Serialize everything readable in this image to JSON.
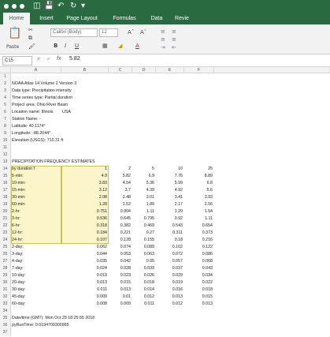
{
  "ribbon": {
    "tabs": [
      {
        "label": "Home",
        "active": true
      },
      {
        "label": "Insert",
        "active": false
      },
      {
        "label": "Page Layout",
        "active": false
      },
      {
        "label": "Formulas",
        "active": false
      },
      {
        "label": "Data",
        "active": false
      },
      {
        "label": "Revie",
        "active": false
      }
    ],
    "paste_label": "Paste",
    "font_name": "Calibri (Body)",
    "font_size": "12",
    "bold": "B",
    "italic": "I",
    "underline": "U"
  },
  "formula_bar": {
    "name_box": "C15",
    "fx": "fx",
    "value": "5.82"
  },
  "columns": [
    "A",
    "B",
    "C",
    "D",
    "E",
    "F"
  ],
  "rows": [
    {
      "n": "1",
      "a": "",
      "b": "",
      "c": "",
      "d": "",
      "e": "",
      "f": ""
    },
    {
      "n": "2",
      "a": "NOAA Atlas 14 Volume 2 Version 3",
      "b": "",
      "c": "",
      "d": "",
      "e": "",
      "f": ""
    },
    {
      "n": "3",
      "a": "Data type: Precipitation intensity",
      "b": "",
      "c": "",
      "d": "",
      "e": "",
      "f": ""
    },
    {
      "n": "4",
      "a": "Time series type: Partial duration",
      "b": "",
      "c": "",
      "d": "",
      "e": "",
      "f": ""
    },
    {
      "n": "5",
      "a": "Project area: Ohio River Basin",
      "b": "",
      "c": "",
      "d": "",
      "e": "",
      "f": ""
    },
    {
      "n": "6",
      "a": "Location name: Illinois",
      "b": "USA",
      "c": "",
      "d": "",
      "e": "",
      "f": ""
    },
    {
      "n": "7",
      "a": "Station Name: -",
      "b": "",
      "c": "",
      "d": "",
      "e": "",
      "f": ""
    },
    {
      "n": "8",
      "a": "Latitude: 40.1174°",
      "b": "",
      "c": "",
      "d": "",
      "e": "",
      "f": ""
    },
    {
      "n": "9",
      "a": "Longitude: -88.2044°",
      "b": "",
      "c": "",
      "d": "",
      "e": "",
      "f": ""
    },
    {
      "n": "10",
      "a": "Elevation (USGS): 710.31 ft",
      "b": "",
      "c": "",
      "d": "",
      "e": "",
      "f": ""
    },
    {
      "n": "11",
      "a": "",
      "b": "",
      "c": "",
      "d": "",
      "e": "",
      "f": ""
    },
    {
      "n": "12",
      "a": "",
      "b": "",
      "c": "",
      "d": "",
      "e": "",
      "f": ""
    },
    {
      "n": "13",
      "a": "PRECIPITATION FREQUENCY ESTIMATES",
      "b": "",
      "c": "",
      "d": "",
      "e": "",
      "f": ""
    },
    {
      "n": "14",
      "a": "by duration f",
      "b": "1",
      "c": "2",
      "d": "5",
      "e": "10",
      "f": "25"
    },
    {
      "n": "15",
      "a": "5-min:",
      "b": "4.9",
      "c": "5.82",
      "d": "6.9",
      "e": "7.76",
      "f": "8.89"
    },
    {
      "n": "16",
      "a": "10-min:",
      "b": "3.83",
      "c": "4.54",
      "d": "5.36",
      "e": "5.99",
      "f": "6.8"
    },
    {
      "n": "17",
      "a": "15-min:",
      "b": "3.12",
      "c": "3.7",
      "d": "4.39",
      "e": "4.92",
      "f": "5.6"
    },
    {
      "n": "18",
      "a": "30-min:",
      "b": "2.08",
      "c": "2.48",
      "d": "3.01",
      "e": "3.41",
      "f": "3.93"
    },
    {
      "n": "19",
      "a": "60-min:",
      "b": "1.28",
      "c": "1.52",
      "d": "1.89",
      "e": "2.17",
      "f": "2.56"
    },
    {
      "n": "20",
      "a": "2-hr:",
      "b": "0.751",
      "c": "0.904",
      "d": "1.11",
      "e": "1.29",
      "f": "1.54"
    },
    {
      "n": "21",
      "a": "3-hr:",
      "b": "0.536",
      "c": "0.645",
      "d": "0.795",
      "e": "0.92",
      "f": "1.11"
    },
    {
      "n": "22",
      "a": "6-hr:",
      "b": "0.318",
      "c": "0.382",
      "d": "0.469",
      "e": "0.543",
      "f": "0.654"
    },
    {
      "n": "23",
      "a": "12-hr:",
      "b": "0.184",
      "c": "0.221",
      "d": "0.27",
      "e": "0.311",
      "f": "0.373"
    },
    {
      "n": "24",
      "a": "24-hr:",
      "b": "0.107",
      "c": "0.128",
      "d": "0.155",
      "e": "0.18",
      "f": "0.216"
    },
    {
      "n": "25",
      "a": "2-day:",
      "b": "0.062",
      "c": "0.074",
      "d": "0.089",
      "e": "0.102",
      "f": "0.122"
    },
    {
      "n": "26",
      "a": "3-day:",
      "b": "0.044",
      "c": "0.053",
      "d": "0.063",
      "e": "0.072",
      "f": "0.086"
    },
    {
      "n": "27",
      "a": "4-day:",
      "b": "0.035",
      "c": "0.042",
      "d": "0.05",
      "e": "0.057",
      "f": "0.068"
    },
    {
      "n": "28",
      "a": "7-day:",
      "b": "0.024",
      "c": "0.028",
      "d": "0.033",
      "e": "0.037",
      "f": "0.043"
    },
    {
      "n": "29",
      "a": "10-day:",
      "b": "0.019",
      "c": "0.023",
      "d": "0.026",
      "e": "0.029",
      "f": "0.034"
    },
    {
      "n": "30",
      "a": "20-day:",
      "b": "0.013",
      "c": "0.015",
      "d": "0.018",
      "e": "0.019",
      "f": "0.022"
    },
    {
      "n": "31",
      "a": "30-day:",
      "b": "0.011",
      "c": "0.013",
      "d": "0.014",
      "e": "0.016",
      "f": "0.018"
    },
    {
      "n": "32",
      "a": "45-day:",
      "b": "0.009",
      "c": "0.01",
      "d": "0.012",
      "e": "0.013",
      "f": "0.015"
    },
    {
      "n": "33",
      "a": "60-day:",
      "b": "0.008",
      "c": "0.009",
      "d": "0.011",
      "e": "0.012",
      "f": "0.013"
    },
    {
      "n": "34",
      "a": "",
      "b": "",
      "c": "",
      "d": "",
      "e": "",
      "f": ""
    },
    {
      "n": "35",
      "a": "Date/time (GMT):  Mon Oct 29 18:25:55 2018",
      "b": "",
      "c": "",
      "d": "",
      "e": "",
      "f": ""
    },
    {
      "n": "36",
      "a": "pyRunTime:  0.0194709300995",
      "b": "",
      "c": "",
      "d": "",
      "e": "",
      "f": ""
    },
    {
      "n": "37",
      "a": "",
      "b": "",
      "c": "",
      "d": "",
      "e": "",
      "f": ""
    }
  ],
  "colors": {
    "excel_green": "#2a6a41",
    "selection_fill": "#fbf5c9",
    "selection_border": "#c9c257"
  }
}
